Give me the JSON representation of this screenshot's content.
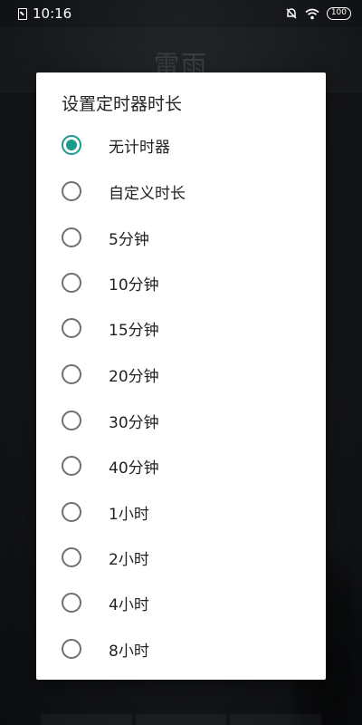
{
  "status_bar": {
    "time": "10:16",
    "battery": "100",
    "icons": [
      "sim-icon",
      "mute-bell-icon",
      "wifi-icon",
      "battery-icon"
    ]
  },
  "background": {
    "title": "雷雨"
  },
  "dialog": {
    "title": "设置定时器时长",
    "accent_color": "#1a9b8a",
    "options": [
      {
        "label": "无计时器",
        "checked": true
      },
      {
        "label": "自定义时长",
        "checked": false
      },
      {
        "label": "5分钟",
        "checked": false
      },
      {
        "label": "10分钟",
        "checked": false
      },
      {
        "label": "15分钟",
        "checked": false
      },
      {
        "label": "20分钟",
        "checked": false
      },
      {
        "label": "30分钟",
        "checked": false
      },
      {
        "label": "40分钟",
        "checked": false
      },
      {
        "label": "1小时",
        "checked": false
      },
      {
        "label": "2小时",
        "checked": false
      },
      {
        "label": "4小时",
        "checked": false
      },
      {
        "label": "8小时",
        "checked": false
      }
    ]
  }
}
